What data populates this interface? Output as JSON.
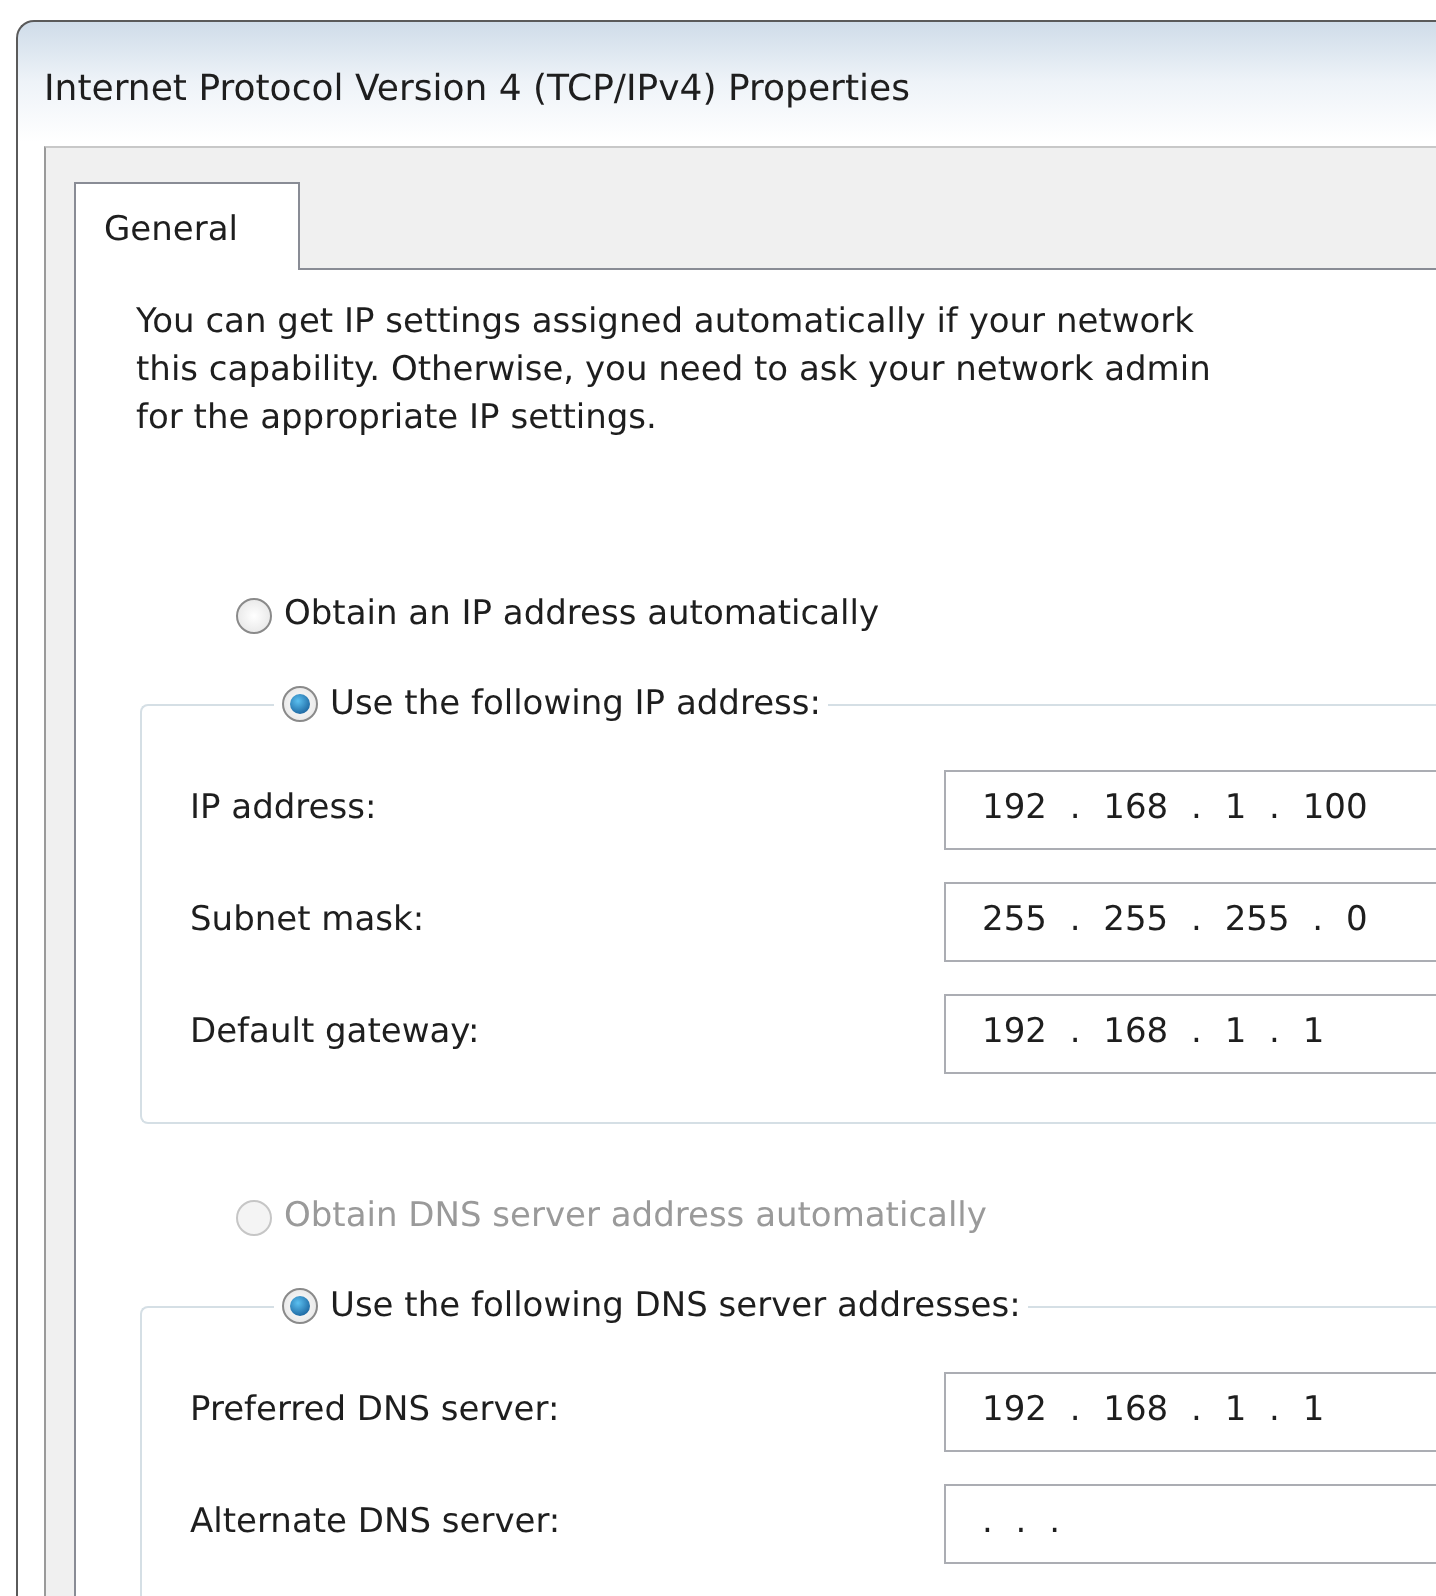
{
  "window": {
    "title": "Internet Protocol Version 4 (TCP/IPv4) Properties"
  },
  "tabs": [
    {
      "label": "General",
      "selected": true
    }
  ],
  "intro_lines": [
    "You can get IP settings assigned automatically if your network",
    "this capability. Otherwise, you need to ask your network admin",
    "for the appropriate IP settings."
  ],
  "sections": [
    {
      "auto_option": {
        "label": "Obtain an IP address automatically",
        "selected": false,
        "disabled": false
      },
      "manual_option": {
        "label": "Use the following IP address:",
        "selected": true,
        "disabled": false
      },
      "fields": [
        {
          "label": "IP address:",
          "value": "192 . 168 . 1 . 100"
        },
        {
          "label": "Subnet mask:",
          "value": "255 . 255 . 255 . 0"
        },
        {
          "label": "Default gateway:",
          "value": "192 . 168 . 1 . 1"
        }
      ]
    },
    {
      "auto_option": {
        "label": "Obtain DNS server address automatically",
        "selected": false,
        "disabled": true
      },
      "manual_option": {
        "label": "Use the following DNS server addresses:",
        "selected": true,
        "disabled": false
      },
      "fields": [
        {
          "label": "Preferred DNS server:",
          "value": "192 . 168 . 1 . 1"
        },
        {
          "label": "Alternate DNS server:",
          "value": ". . ."
        }
      ]
    }
  ]
}
